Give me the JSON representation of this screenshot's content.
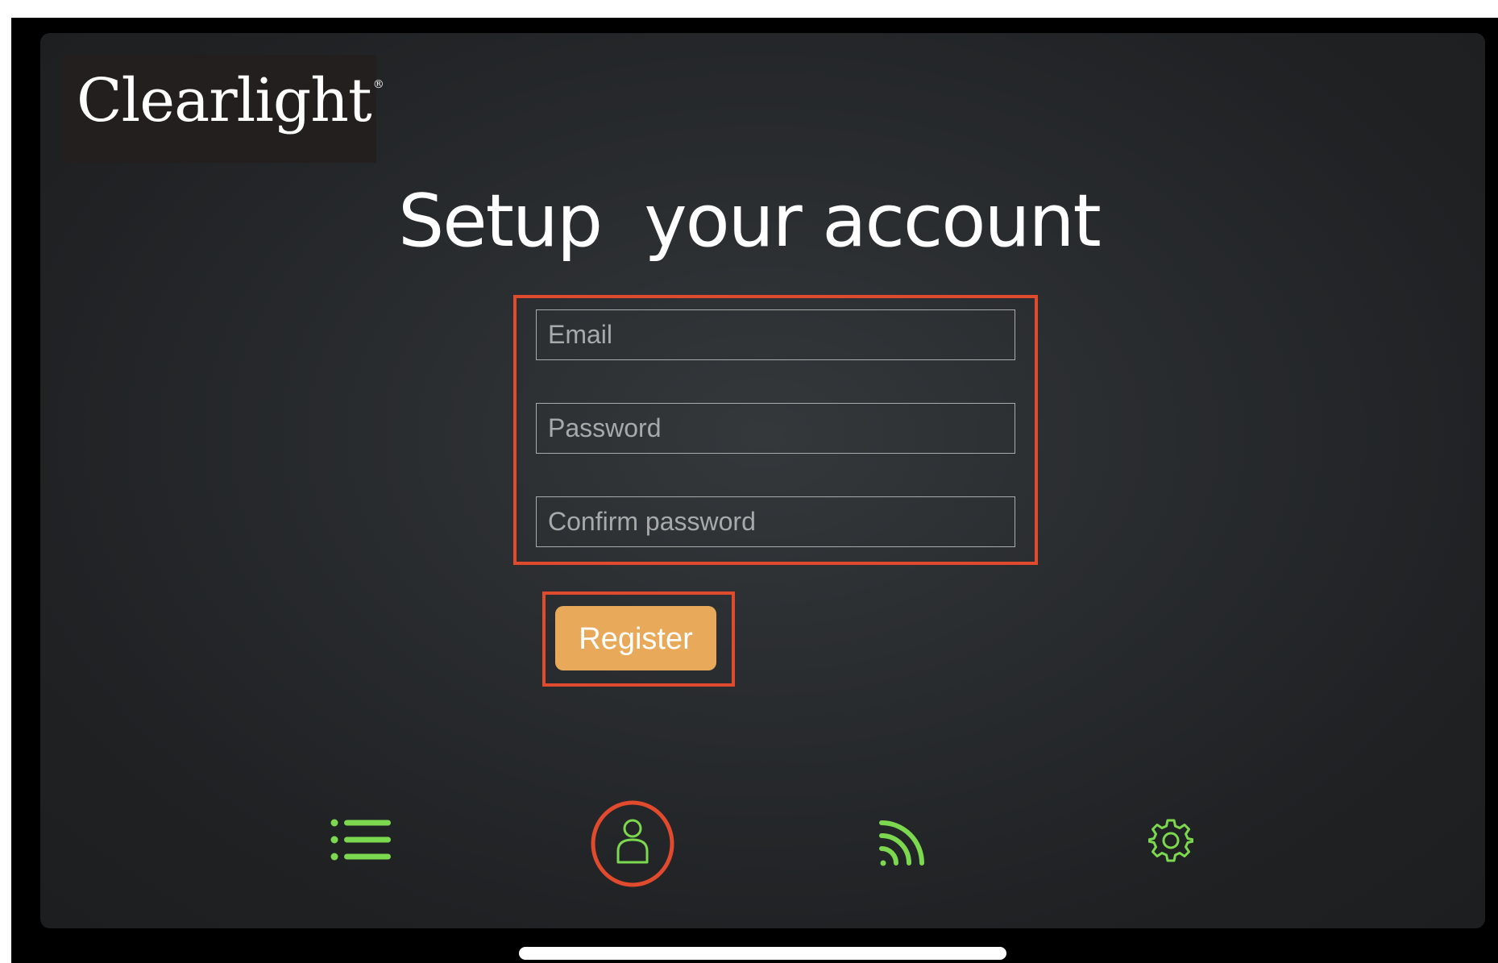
{
  "app": {
    "brand": "Clearlight",
    "brand_mark": "®"
  },
  "page": {
    "title": "Setup  your account"
  },
  "form": {
    "email_placeholder": "Email",
    "password_placeholder": "Password",
    "confirm_password_placeholder": "Confirm password",
    "register_label": "Register"
  },
  "nav": {
    "items": [
      {
        "icon": "list-icon",
        "selected": false
      },
      {
        "icon": "account-icon",
        "selected": true
      },
      {
        "icon": "wifi-icon",
        "selected": false
      },
      {
        "icon": "gear-icon",
        "selected": false
      }
    ]
  },
  "colors": {
    "background": "#2a2d30",
    "highlight": "#e24a2e",
    "accent_button": "#e8aa5a",
    "nav_icon": "#7cd84e",
    "text": "#ffffff"
  }
}
